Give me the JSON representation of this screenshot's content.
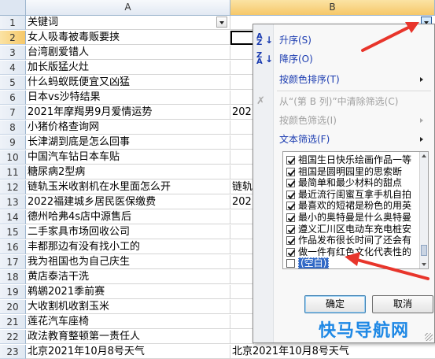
{
  "columns": [
    "A",
    "B"
  ],
  "rows": [
    {
      "num": "1",
      "a": "关键词",
      "b": ""
    },
    {
      "num": "2",
      "a": "女人吸毒被毒贩要挟",
      "b": ""
    },
    {
      "num": "3",
      "a": "台湾剧爱错人",
      "b": ""
    },
    {
      "num": "4",
      "a": "加长版猛火灶",
      "b": ""
    },
    {
      "num": "5",
      "a": "什么蚂蚁既便宜又凶猛",
      "b": ""
    },
    {
      "num": "6",
      "a": "日本vs沙特结果",
      "b": ""
    },
    {
      "num": "7",
      "a": "2021年摩羯男9月爱情运势",
      "b": "202"
    },
    {
      "num": "8",
      "a": "小猪价格查询网",
      "b": ""
    },
    {
      "num": "9",
      "a": "长津湖到底是怎么回事",
      "b": ""
    },
    {
      "num": "10",
      "a": "中国汽车钻日本车贴",
      "b": ""
    },
    {
      "num": "11",
      "a": "糖尿病2型病",
      "b": ""
    },
    {
      "num": "12",
      "a": "链轨玉米收割机在水里面怎么开",
      "b": "链轨"
    },
    {
      "num": "13",
      "a": "2022福建城乡居民医保缴费",
      "b": "202"
    },
    {
      "num": "14",
      "a": "德州哈弗4s店中源售后",
      "b": ""
    },
    {
      "num": "15",
      "a": "二手家具市场回收公司",
      "b": ""
    },
    {
      "num": "16",
      "a": "丰都那边有没有找小工的",
      "b": ""
    },
    {
      "num": "17",
      "a": "我为祖国也为自己庆生",
      "b": ""
    },
    {
      "num": "18",
      "a": "黄店泰洁干洗",
      "b": ""
    },
    {
      "num": "19",
      "a": "鹈鹕2021季前赛",
      "b": ""
    },
    {
      "num": "20",
      "a": "大收割机收割玉米",
      "b": ""
    },
    {
      "num": "21",
      "a": "莲花汽车座椅",
      "b": ""
    },
    {
      "num": "22",
      "a": "政法教育整顿第一责任人",
      "b": ""
    },
    {
      "num": "23",
      "a": "北京2021年10月8号天气",
      "b": "北京2021年10月8号天气"
    }
  ],
  "filter_menu": {
    "sort_asc": "升序(S)",
    "sort_desc": "降序(O)",
    "sort_by_color": "按颜色排序(T)",
    "clear_filter": "从“(第 B 列)”中清除筛选(C)",
    "filter_by_color": "按颜色筛选(I)",
    "text_filter": "文本筛选(F)",
    "list_items": [
      {
        "label": "祖国生日快乐绘画作品一等",
        "checked": true
      },
      {
        "label": "祖国是圆明园里的思索断",
        "checked": true
      },
      {
        "label": "最简单和最少材料的甜点",
        "checked": true
      },
      {
        "label": "最近流行闺蜜互拿手机自拍",
        "checked": true
      },
      {
        "label": "最喜欢的短裙是粉色的用英",
        "checked": true
      },
      {
        "label": "最小的奥特曼是什么奥特曼",
        "checked": true
      },
      {
        "label": "遵义汇川区电动车充电桩安",
        "checked": true
      },
      {
        "label": "作品发布很长时间了还会有",
        "checked": true
      },
      {
        "label": "做一件有红色文化代表性的",
        "checked": true
      },
      {
        "label": "(空白)",
        "checked": false
      }
    ],
    "ok_label": "确定",
    "cancel_label": "取消"
  },
  "watermark": "快马导航网",
  "colors": {
    "accent_red": "#e8352b",
    "selection_blue": "#3169c6"
  }
}
